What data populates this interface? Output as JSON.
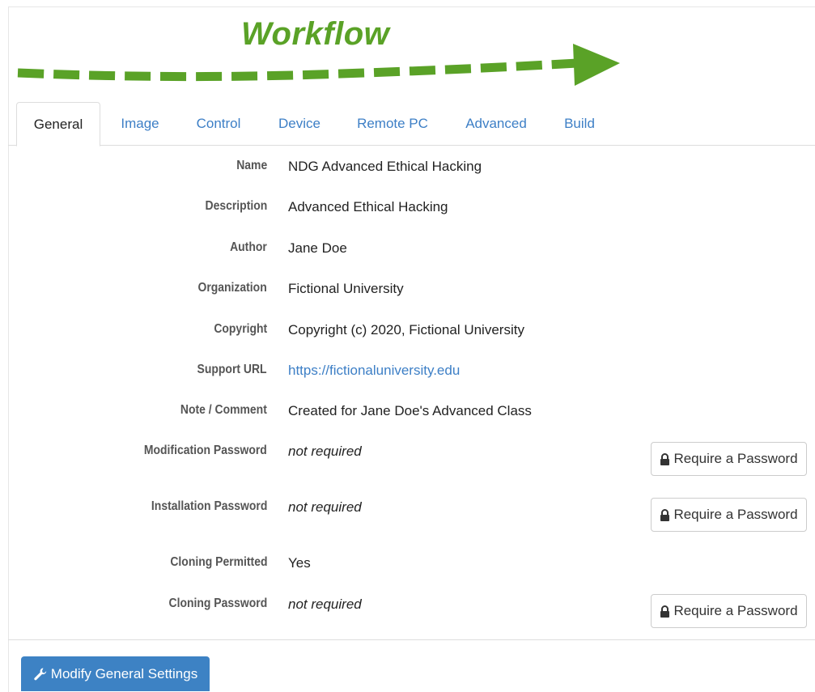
{
  "workflow": {
    "title": "Workflow",
    "arrow_color": "#5aa227"
  },
  "tabs": [
    {
      "label": "General",
      "active": true
    },
    {
      "label": "Image",
      "active": false
    },
    {
      "label": "Control",
      "active": false
    },
    {
      "label": "Device",
      "active": false
    },
    {
      "label": "Remote PC",
      "active": false
    },
    {
      "label": "Advanced",
      "active": false
    },
    {
      "label": "Build",
      "active": false
    }
  ],
  "fields": {
    "name": {
      "label": "Name",
      "value": "NDG Advanced Ethical Hacking"
    },
    "description": {
      "label": "Description",
      "value": "Advanced Ethical Hacking"
    },
    "author": {
      "label": "Author",
      "value": "Jane Doe"
    },
    "organization": {
      "label": "Organization",
      "value": "Fictional University"
    },
    "copyright": {
      "label": "Copyright",
      "value": "Copyright (c) 2020, Fictional University"
    },
    "support_url": {
      "label": "Support URL",
      "value": "https://fictionaluniversity.edu"
    },
    "note": {
      "label": "Note / Comment",
      "value": "Created for Jane Doe's Advanced Class"
    },
    "modification_password": {
      "label": "Modification Password",
      "value": "not required",
      "button": "Require a Password"
    },
    "installation_password": {
      "label": "Installation Password",
      "value": "not required",
      "button": "Require a Password"
    },
    "cloning_permitted": {
      "label": "Cloning Permitted",
      "value": "Yes"
    },
    "cloning_password": {
      "label": "Cloning Password",
      "value": "not required",
      "button": "Require a Password"
    }
  },
  "footer": {
    "modify_button": "Modify General Settings",
    "modify_button_color": "#3d82c4"
  },
  "colors": {
    "link": "#3d7fc6",
    "label": "#555555"
  }
}
